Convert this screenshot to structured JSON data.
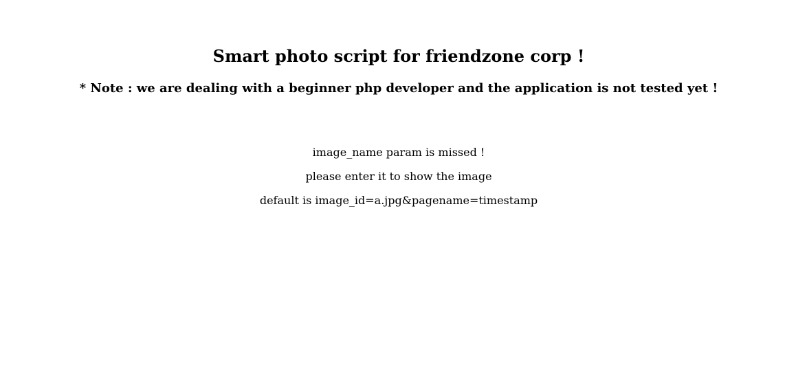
{
  "page": {
    "title": "Smart photo script for friendzone corp !",
    "note": "* Note : we are dealing with a beginner php developer and the application is not tested yet !",
    "messages": [
      "image_name param is missed !",
      "please enter it to show the image",
      "default is image_id=a.jpg&pagename=timestamp"
    ]
  }
}
